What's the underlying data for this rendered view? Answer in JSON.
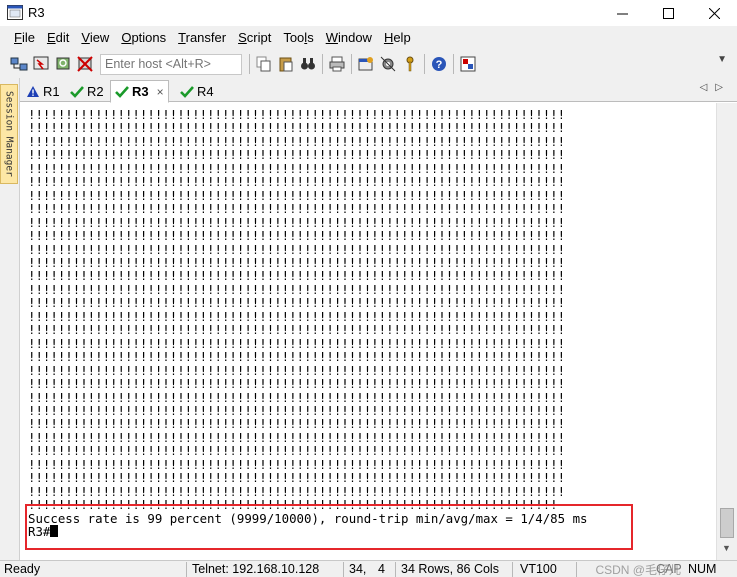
{
  "window": {
    "title": "R3"
  },
  "menu": [
    {
      "pre": "",
      "ul": "F",
      "post": "ile"
    },
    {
      "pre": "",
      "ul": "E",
      "post": "dit"
    },
    {
      "pre": "",
      "ul": "V",
      "post": "iew"
    },
    {
      "pre": "",
      "ul": "O",
      "post": "ptions"
    },
    {
      "pre": "",
      "ul": "T",
      "post": "ransfer"
    },
    {
      "pre": "",
      "ul": "S",
      "post": "cript"
    },
    {
      "pre": "Too",
      "ul": "l",
      "post": "s"
    },
    {
      "pre": "",
      "ul": "W",
      "post": "indow"
    },
    {
      "pre": "",
      "ul": "H",
      "post": "elp"
    }
  ],
  "toolbar": {
    "host_placeholder": "Enter host <Alt+R>"
  },
  "session_manager": {
    "label": "Session Manager"
  },
  "tabs": [
    {
      "label": "R1",
      "status": "warning"
    },
    {
      "label": "R2",
      "status": "connected"
    },
    {
      "label": "R3",
      "status": "connected",
      "active": true,
      "close": "×"
    },
    {
      "label": "R4",
      "status": "connected"
    }
  ],
  "terminal": {
    "bang_line": "!!!!!!!!!!!!!!!!!!!!!!!!!!!!!!!!!!!!!!!!!!!!!!!!!!!!!!!!!!!!!!!!!!!!!!!!",
    "bang_line_count": 29,
    "last_bang_line": "!!!!!!!!!!!!!!!!!!!!!!!!!!!!!!!!!!!!!!!!!!!!!!!!!!!!!!!!!!!!!!!!!!!!!!!",
    "result_line": "Success rate is 99 percent (9999/10000), round-trip min/avg/max = 1/4/85 ms",
    "prompt": "R3#"
  },
  "status": {
    "ready": "Ready",
    "connection": "Telnet: 192.168.10.128",
    "row": "34,",
    "col": "4",
    "size": "34 Rows, 86 Cols",
    "emulation": "VT100",
    "cap": "CAP",
    "num": "NUM"
  },
  "watermark": "CSDN @毛仔儿",
  "colors": {
    "highlight": "#e5262b",
    "check": "#1a9a2a",
    "warning": "#1d3fb5"
  }
}
